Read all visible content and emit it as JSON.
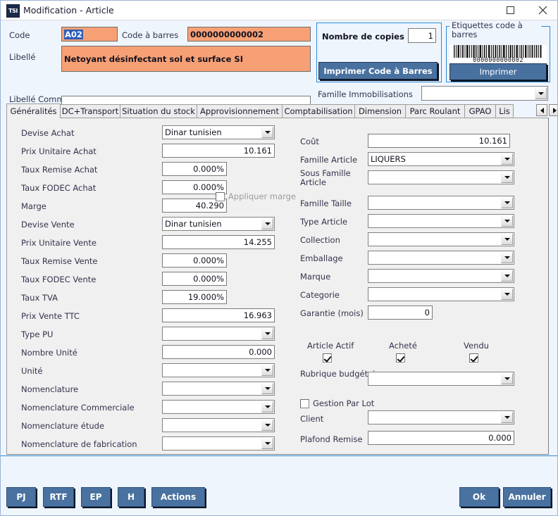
{
  "window": {
    "title": "Modification - Article",
    "app_icon": "TSI",
    "maximize_label": "maximize",
    "close_label": "close"
  },
  "header": {
    "code_label": "Code",
    "code_value": "A02",
    "barcode_label": "Code à barres",
    "barcode_value": "0000000000002",
    "libelle_label": "Libellé",
    "libelle_value": "Netoyant désinfectant sol et surface SI",
    "libelle_commercial_label": "Libellé Commercial",
    "libelle_commercial_value": "",
    "copies_group": {
      "copies_label": "Nombre de copies",
      "copies_value": "1",
      "print_button": "Imprimer Code à Barres"
    },
    "labels_group": {
      "title": "Etiquettes code à barres",
      "barcode_digits": "0000000000002",
      "print_button": "Imprimer"
    },
    "famille_immo_label": "Famille Immobilisations",
    "famille_immo_value": ""
  },
  "tabs": {
    "items": [
      {
        "label": "Généralités",
        "active": true
      },
      {
        "label": "DC+Transport",
        "active": false
      },
      {
        "label": "Situation du stock",
        "active": false
      },
      {
        "label": "Approvisionnement",
        "active": false
      },
      {
        "label": "Comptabilisation",
        "active": false
      },
      {
        "label": "Dimension",
        "active": false
      },
      {
        "label": "Parc Roulant",
        "active": false
      },
      {
        "label": "GPAO",
        "active": false
      },
      {
        "label": "Lis",
        "active": false
      }
    ],
    "scroll_prev": "◀",
    "scroll_next": "▶"
  },
  "left_column": [
    {
      "label": "Devise Achat",
      "value": "Dinar tunisien",
      "type": "combo"
    },
    {
      "label": "Prix Unitaire Achat",
      "value": "10.161",
      "type": "num-wide"
    },
    {
      "label": "Taux Remise Achat",
      "value": "0.000%",
      "type": "num-narrow"
    },
    {
      "label": "Taux FODEC Achat",
      "value": "0.000%",
      "type": "num-narrow"
    },
    {
      "label": "Marge",
      "value": "40.290",
      "type": "num-narrow"
    },
    {
      "label": "Devise Vente",
      "value": "Dinar tunisien",
      "type": "combo"
    },
    {
      "label": "Prix Unitaire Vente",
      "value": "14.255",
      "type": "num-wide"
    },
    {
      "label": "Taux Remise Vente",
      "value": "0.000%",
      "type": "num-narrow"
    },
    {
      "label": "Taux FODEC Vente",
      "value": "0.000%",
      "type": "num-narrow"
    },
    {
      "label": "Taux TVA",
      "value": "19.000%",
      "type": "num-narrow"
    },
    {
      "label": "Prix Vente TTC",
      "value": "16.963",
      "type": "num-wide"
    },
    {
      "label": "Type PU",
      "value": "",
      "type": "combo"
    },
    {
      "label": "Nombre Unité",
      "value": "0.000",
      "type": "num-wide"
    },
    {
      "label": "Unité",
      "value": "",
      "type": "combo"
    },
    {
      "label": "Nomenclature",
      "value": "",
      "type": "combo"
    },
    {
      "label": "Nomenclature Commerciale",
      "value": "",
      "type": "combo"
    },
    {
      "label": "Nomenclature étude",
      "value": "",
      "type": "combo"
    },
    {
      "label": "Nomenclature de fabrication",
      "value": "",
      "type": "combo"
    }
  ],
  "marge_checkbox": {
    "label": "Appliquer marge",
    "checked": false,
    "disabled": true
  },
  "right_column": [
    {
      "label": "Coût",
      "value": "10.161",
      "type": "num-wide"
    },
    {
      "label": "Famille Article",
      "value": "LIQUERS",
      "type": "combo"
    },
    {
      "label": "Sous Famille Article",
      "value": "",
      "type": "combo"
    },
    {
      "label": "Famille Taille",
      "value": "",
      "type": "combo"
    },
    {
      "label": "Type Article",
      "value": "",
      "type": "combo"
    },
    {
      "label": "Collection",
      "value": "",
      "type": "combo"
    },
    {
      "label": "Emballage",
      "value": "",
      "type": "combo"
    },
    {
      "label": "Marque",
      "value": "",
      "type": "combo"
    },
    {
      "label": "Categorie",
      "value": "",
      "type": "combo"
    },
    {
      "label": "Garantie (mois)",
      "value": "0",
      "type": "num-small"
    }
  ],
  "flags": [
    {
      "label": "Article Actif",
      "checked": true
    },
    {
      "label": "Acheté",
      "checked": true
    },
    {
      "label": "Vendu",
      "checked": true
    }
  ],
  "right_bottom": {
    "rubrique_label": "Rubrique budgétaire",
    "rubrique_value": "",
    "gestion_lot_label": "Gestion Par Lot",
    "gestion_lot_checked": false,
    "client_label": "Client",
    "client_value": "",
    "plafond_label": "Plafond Remise",
    "plafond_value": "0.000"
  },
  "footer": {
    "left_buttons": [
      "PJ",
      "RTF",
      "EP",
      "H",
      "Actions"
    ],
    "right_buttons": [
      "Ok",
      "Annuler"
    ]
  },
  "colors": {
    "accent_blue": "#2e8bd8",
    "button_blue": "#4a72a0",
    "highlight_orange": "#f7a075",
    "selection_blue": "#2b5dbb",
    "panel_gray": "#f0f0f0",
    "window_bg": "#eef5fd"
  }
}
